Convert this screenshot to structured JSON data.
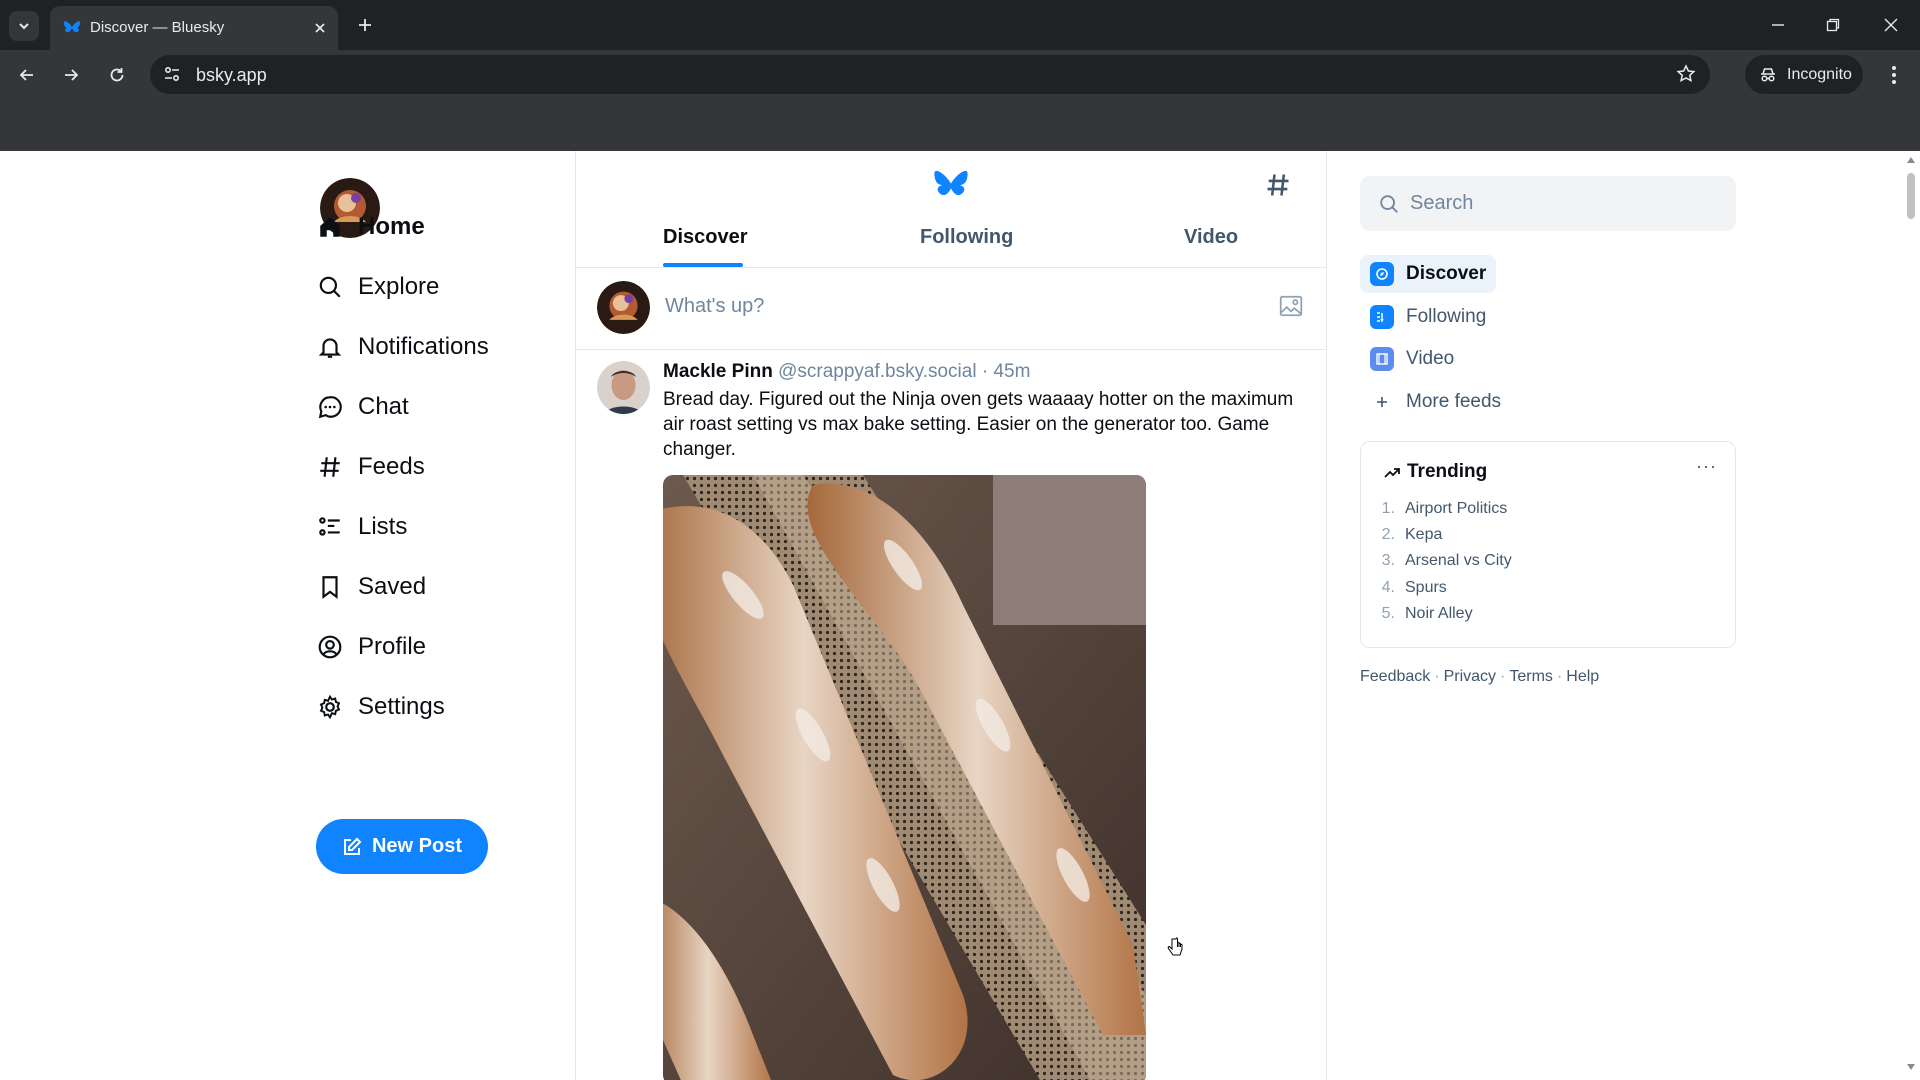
{
  "browser": {
    "tab_title": "Discover — Bluesky",
    "url": "bsky.app",
    "incognito_label": "Incognito"
  },
  "nav": {
    "items": [
      {
        "label": "Home",
        "icon": "home-icon"
      },
      {
        "label": "Explore",
        "icon": "search-icon"
      },
      {
        "label": "Notifications",
        "icon": "bell-icon"
      },
      {
        "label": "Chat",
        "icon": "chat-icon"
      },
      {
        "label": "Feeds",
        "icon": "hash-icon"
      },
      {
        "label": "Lists",
        "icon": "list-icon"
      },
      {
        "label": "Saved",
        "icon": "bookmark-icon"
      },
      {
        "label": "Profile",
        "icon": "profile-icon"
      },
      {
        "label": "Settings",
        "icon": "gear-icon"
      }
    ],
    "new_post_label": "New Post"
  },
  "feed": {
    "tabs": [
      "Discover",
      "Following",
      "Video"
    ],
    "composer_placeholder": "What's up?",
    "post": {
      "author": "Mackle Pinn",
      "handle": "@scrappyaf.bsky.social",
      "separator": "·",
      "time": "45m",
      "text": "Bread day. Figured out the Ninja oven gets waaaay hotter on the maximum air roast setting vs max bake setting. Easier on the generator too. Game changer."
    }
  },
  "sidebar": {
    "search_placeholder": "Search",
    "feeds": [
      "Discover",
      "Following",
      "Video"
    ],
    "more_feeds": "More feeds",
    "trending_title": "Trending",
    "trending": [
      {
        "num": "1.",
        "label": "Airport Politics"
      },
      {
        "num": "2.",
        "label": "Kepa"
      },
      {
        "num": "3.",
        "label": "Arsenal vs City"
      },
      {
        "num": "4.",
        "label": "Spurs"
      },
      {
        "num": "5.",
        "label": "Noir Alley"
      }
    ],
    "footer": [
      "Feedback",
      "Privacy",
      "Terms",
      "Help"
    ]
  },
  "colors": {
    "brand": "#1083fe",
    "chrome_dark": "#202124",
    "chrome_mid": "#35363a"
  }
}
